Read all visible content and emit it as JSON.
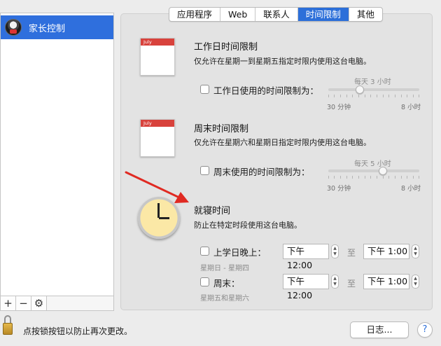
{
  "sidebar": {
    "items": [
      {
        "label": "家长控制",
        "icon": "child-avatar-icon"
      }
    ]
  },
  "sidebar_toolbar": {
    "add": "+",
    "remove": "−",
    "settings": "⚙"
  },
  "tabs": [
    {
      "label": "应用程序"
    },
    {
      "label": "Web"
    },
    {
      "label": "联系人"
    },
    {
      "label": "时间限制",
      "active": true
    },
    {
      "label": "其他"
    }
  ],
  "weekday": {
    "title": "工作日时间限制",
    "description": "仅允许在星期一到星期五指定时限内使用这台电脑。",
    "checkbox_label": "工作日使用的时间限制为：",
    "checked": false,
    "caption": "每天 3 小时",
    "min_label": "30 分钟",
    "max_label": "8 小时",
    "hours": 3
  },
  "weekend": {
    "title": "周末时间限制",
    "description": "仅允许在星期六和星期日指定时限内使用这台电脑。",
    "checkbox_label": "周末使用的时间限制为：",
    "checked": false,
    "caption": "每天 5 小时",
    "min_label": "30 分钟",
    "max_label": "8 小时",
    "hours": 5
  },
  "calendar": {
    "month": "July"
  },
  "bedtime": {
    "title": "就寝时间",
    "description": "防止在特定时段使用这台电脑。",
    "school_night": {
      "label": "上学日晚上：",
      "sub": "星期日 - 星期四",
      "from": "下午12:00",
      "to": "下午  1:00",
      "to_label": "至"
    },
    "weekend": {
      "label": "周末：",
      "sub": "星期五和星期六",
      "from": "下午12:00",
      "to": "下午  1:00",
      "to_label": "至"
    }
  },
  "footer": {
    "lock_text": "点按锁按钮以防止再次更改。",
    "log_button": "日志...",
    "help": "?"
  },
  "colors": {
    "accent": "#2c6fd9",
    "arrow": "#e02a22"
  }
}
